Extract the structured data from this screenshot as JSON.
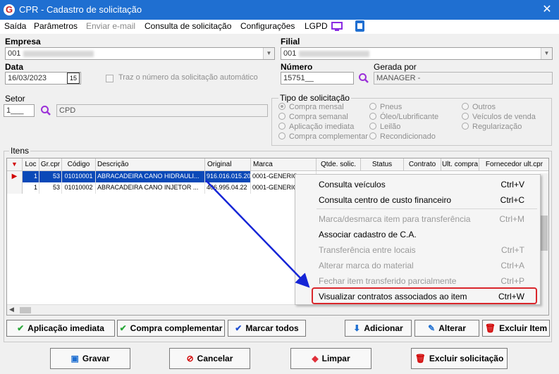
{
  "window": {
    "title": "CPR - Cadastro de solicitação",
    "logo": "G",
    "close": "✕"
  },
  "menu": {
    "items": [
      "Saída",
      "Parâmetros",
      "Enviar e-mail",
      "Consulta de solicitação",
      "Configurações",
      "LGPD"
    ]
  },
  "form": {
    "empresa_label": "Empresa",
    "empresa_code": "001",
    "filial_label": "Filial",
    "filial_code": "001",
    "data_label": "Data",
    "data_value": "16/03/2023",
    "auto_numero_label": "Traz o número da solicitação automático",
    "numero_label": "Número",
    "numero_value": "15751__",
    "gerada_label": "Gerada por",
    "gerada_value": "MANAGER -",
    "setor_label": "Setor",
    "setor_code": "1___",
    "setor_name": "CPD",
    "tipo_label": "Tipo de solicitação",
    "tipo_options": [
      [
        "Compra mensal",
        "Compra semanal",
        "Aplicação imediata",
        "Compra complementar"
      ],
      [
        "Pneus",
        "Óleo/Lubrificante",
        "Leilão",
        "Recondicionado"
      ],
      [
        "Outros",
        "Veículos de venda",
        "Regularização"
      ]
    ]
  },
  "itens": {
    "label": "Itens",
    "columns": [
      "Loc",
      "Gr.cpr",
      "Código",
      "Descrição",
      "Original",
      "Marca",
      "Qtde. solic.",
      "Status",
      "Contrato",
      "Ult. compra",
      "Fornecedor ult.cpr"
    ],
    "rows": [
      {
        "loc": "1",
        "gr": "53",
        "codigo": "01010001",
        "descricao": "ABRACADEIRA CANO HIDRAULI...",
        "original": "916.016.015.200",
        "marca": "0001-GENERIC"
      },
      {
        "loc": "1",
        "gr": "53",
        "codigo": "01010002",
        "descricao": "ABRACADEIRA CANO INJETOR ...",
        "original": "406.995.04.22",
        "marca": "0001-GENERIC"
      }
    ]
  },
  "context_menu": [
    {
      "label": "Consulta veículos",
      "shortcut": "Ctrl+V",
      "enabled": true
    },
    {
      "label": "Consulta centro de custo financeiro",
      "shortcut": "Ctrl+C",
      "enabled": true
    },
    {
      "label": "Marca/desmarca item para transferência",
      "shortcut": "Ctrl+M",
      "enabled": false
    },
    {
      "label": "Associar cadastro de C.A.",
      "shortcut": "",
      "enabled": true
    },
    {
      "label": "Transferência entre locais",
      "shortcut": "Ctrl+T",
      "enabled": false
    },
    {
      "label": "Alterar marca do material",
      "shortcut": "Ctrl+A",
      "enabled": false
    },
    {
      "label": "Fechar item transferido parcialmente",
      "shortcut": "Ctrl+P",
      "enabled": false
    },
    {
      "label": "Visualizar contratos associados ao item",
      "shortcut": "Ctrl+W",
      "enabled": true
    }
  ],
  "buttons": {
    "aplicacao": "Aplicação imediata",
    "complementar": "Compra complementar",
    "marcar": "Marcar todos",
    "adicionar": "Adicionar",
    "alterar": "Alterar",
    "excluir_item": "Excluir Item",
    "gravar": "Gravar",
    "cancelar": "Cancelar",
    "limpar": "Limpar",
    "excluir_sol": "Excluir solicitação"
  },
  "colors": {
    "accent": "#1f6fd1",
    "selection": "#0a49b8",
    "highlight": "#d9262b",
    "arrow": "#1525d6"
  }
}
